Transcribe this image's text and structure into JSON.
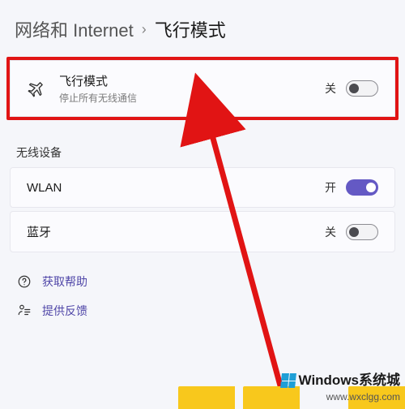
{
  "breadcrumb": {
    "parent": "网络和 Internet",
    "separator": "›",
    "current": "飞行模式"
  },
  "airplane": {
    "icon": "airplane-icon",
    "title": "飞行模式",
    "subtitle": "停止所有无线通信",
    "state_label": "关",
    "on": false
  },
  "wireless": {
    "header": "无线设备",
    "items": [
      {
        "name": "WLAN",
        "state_label": "开",
        "on": true
      },
      {
        "name": "蓝牙",
        "state_label": "关",
        "on": false
      }
    ]
  },
  "links": {
    "help": "获取帮助",
    "feedback": "提供反馈"
  },
  "watermark": {
    "line1": "Windows系统城",
    "line2": "www.wxclgg.com"
  },
  "colors": {
    "accent": "#6459c4",
    "highlight": "#e11414"
  }
}
